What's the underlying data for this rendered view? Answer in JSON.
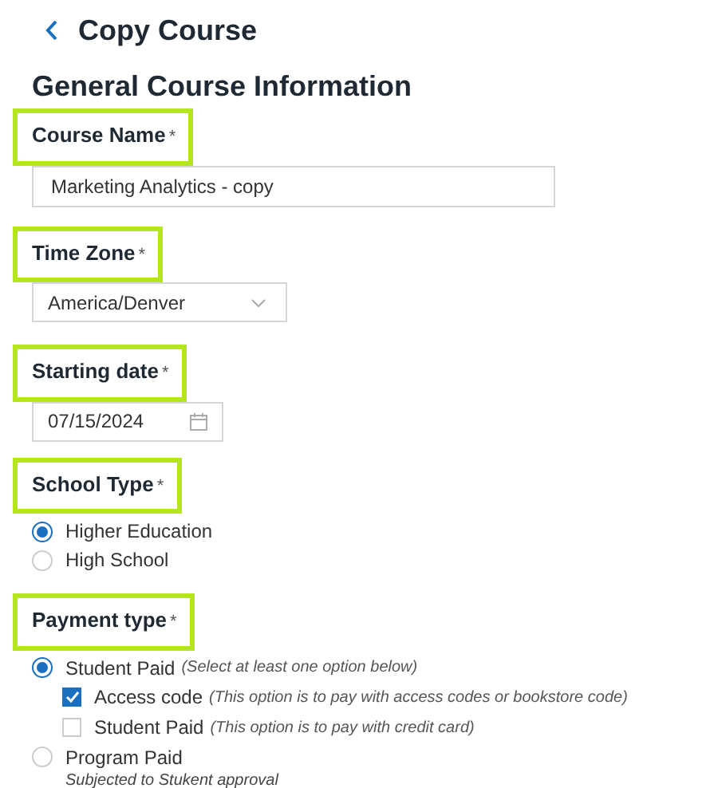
{
  "header": {
    "title": "Copy Course"
  },
  "section_title": "General Course Information",
  "fields": [
    {
      "kind": "text",
      "label": "Course Name",
      "required_mark": "*",
      "value": "Marketing Analytics - copy"
    },
    {
      "kind": "select",
      "label": "Time Zone",
      "required_mark": "*",
      "value": "America/Denver"
    },
    {
      "kind": "date",
      "label": "Starting date",
      "required_mark": "*",
      "value": "07/15/2024"
    },
    {
      "kind": "radio_group",
      "label": "School Type",
      "required_mark": "*",
      "options": [
        {
          "label": "Higher Education",
          "selected": true
        },
        {
          "label": "High School",
          "selected": false
        }
      ]
    },
    {
      "kind": "radio_group",
      "label": "Payment type",
      "required_mark": "*",
      "options": [
        {
          "label": "Student Paid",
          "hint": "(Select at least one option below)",
          "selected": true,
          "children": [
            {
              "label": "Access code",
              "hint": "(This option is to pay with access codes or bookstore code)",
              "checked": true
            },
            {
              "label": "Student Paid",
              "hint": "(This option is to pay with credit card)",
              "checked": false
            }
          ]
        },
        {
          "label": "Program Paid",
          "note": "Subjected to Stukent approval",
          "selected": false
        }
      ]
    }
  ]
}
